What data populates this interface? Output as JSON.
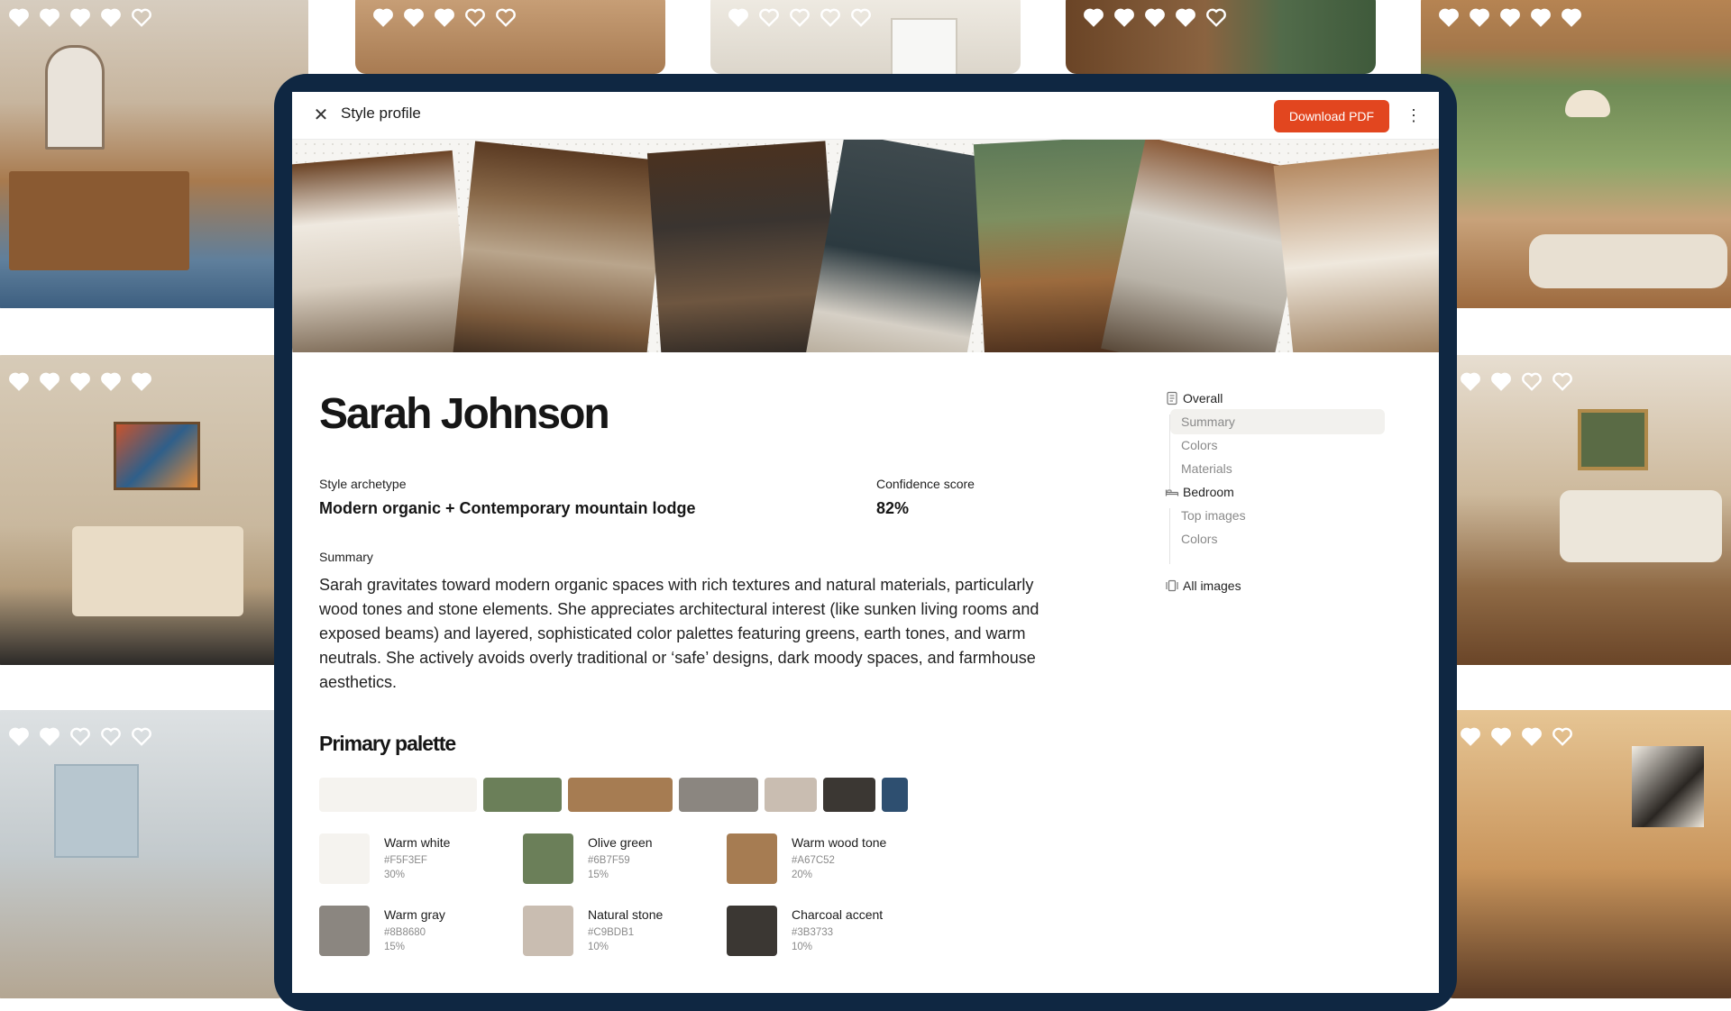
{
  "tiles": [
    {
      "name": "tile-bathroom",
      "hearts": [
        1,
        1,
        1,
        1,
        0
      ],
      "color": "#a87a4e"
    },
    {
      "name": "tile-hall",
      "hearts": [
        1,
        1,
        1,
        0,
        0
      ],
      "color": "#b4885e"
    },
    {
      "name": "tile-bright-room",
      "hearts": [
        1,
        0,
        0,
        0,
        0
      ],
      "color": "#e2ddd2"
    },
    {
      "name": "tile-wood-room",
      "hearts": [
        1,
        1,
        1,
        1,
        0
      ],
      "color": "#7b5232"
    },
    {
      "name": "tile-living-windows",
      "hearts": [
        1,
        1,
        1,
        1,
        1
      ],
      "color": "#9c6d42"
    },
    {
      "name": "tile-bedroom",
      "hearts": [
        1,
        1,
        1,
        1,
        1
      ],
      "color": "#b9a68a"
    },
    {
      "name": "tile-parlor",
      "hearts": [
        1,
        1,
        0,
        0
      ],
      "color": "#8f6a45"
    },
    {
      "name": "tile-kitchen",
      "hearts": [
        1,
        1,
        0,
        0,
        0
      ],
      "color": "#c9cdd0"
    },
    {
      "name": "tile-dining",
      "hearts": [
        1,
        1,
        1,
        0
      ],
      "color": "#c9955c"
    }
  ],
  "modal": {
    "title": "Style profile",
    "close_icon": "close-icon",
    "download_label": "Download PDF",
    "more_icon": "kebab-menu-icon"
  },
  "profile": {
    "name": "Sarah Johnson",
    "archetype_label": "Style archetype",
    "archetype_value": "Modern organic + Contemporary mountain lodge",
    "confidence_label": "Confidence score",
    "confidence_value": "82%",
    "confidence_fraction": 0.82,
    "summary_label": "Summary",
    "summary_text": "Sarah gravitates toward modern organic spaces with rich textures and natural materials, particularly wood tones and stone elements. She appreciates architectural interest (like sunken living rooms and exposed beams) and layered, sophisticated color palettes featuring greens, earth tones, and warm neutrals. She actively avoids overly traditional or ‘safe’ designs, dark moody spaces, and farmhouse aesthetics."
  },
  "palette": {
    "title": "Primary palette",
    "colors": [
      {
        "name": "Warm white",
        "hex": "#F5F3EF",
        "pct": "30%",
        "share": 0.3
      },
      {
        "name": "Olive green",
        "hex": "#6B7F59",
        "pct": "15%",
        "share": 0.15
      },
      {
        "name": "Warm wood tone",
        "hex": "#A67C52",
        "pct": "20%",
        "share": 0.2
      },
      {
        "name": "Warm gray",
        "hex": "#8B8680",
        "pct": "15%",
        "share": 0.15
      },
      {
        "name": "Natural stone",
        "hex": "#C9BDB1",
        "pct": "10%",
        "share": 0.1
      },
      {
        "name": "Charcoal accent",
        "hex": "#3B3733",
        "pct": "10%",
        "share": 0.1
      },
      {
        "hex": "#2E4F70",
        "share": 0.05
      }
    ]
  },
  "nav": {
    "overall": {
      "label": "Overall",
      "icon": "document-icon"
    },
    "overall_items": [
      "Summary",
      "Colors",
      "Materials"
    ],
    "bedroom": {
      "label": "Bedroom",
      "icon": "bed-icon"
    },
    "bedroom_items": [
      "Top images",
      "Colors"
    ],
    "all_images": {
      "label": "All images",
      "icon": "gallery-icon"
    },
    "active": "Summary"
  },
  "colors": {
    "accent": "#E2461F",
    "frame": "#0F2742"
  }
}
